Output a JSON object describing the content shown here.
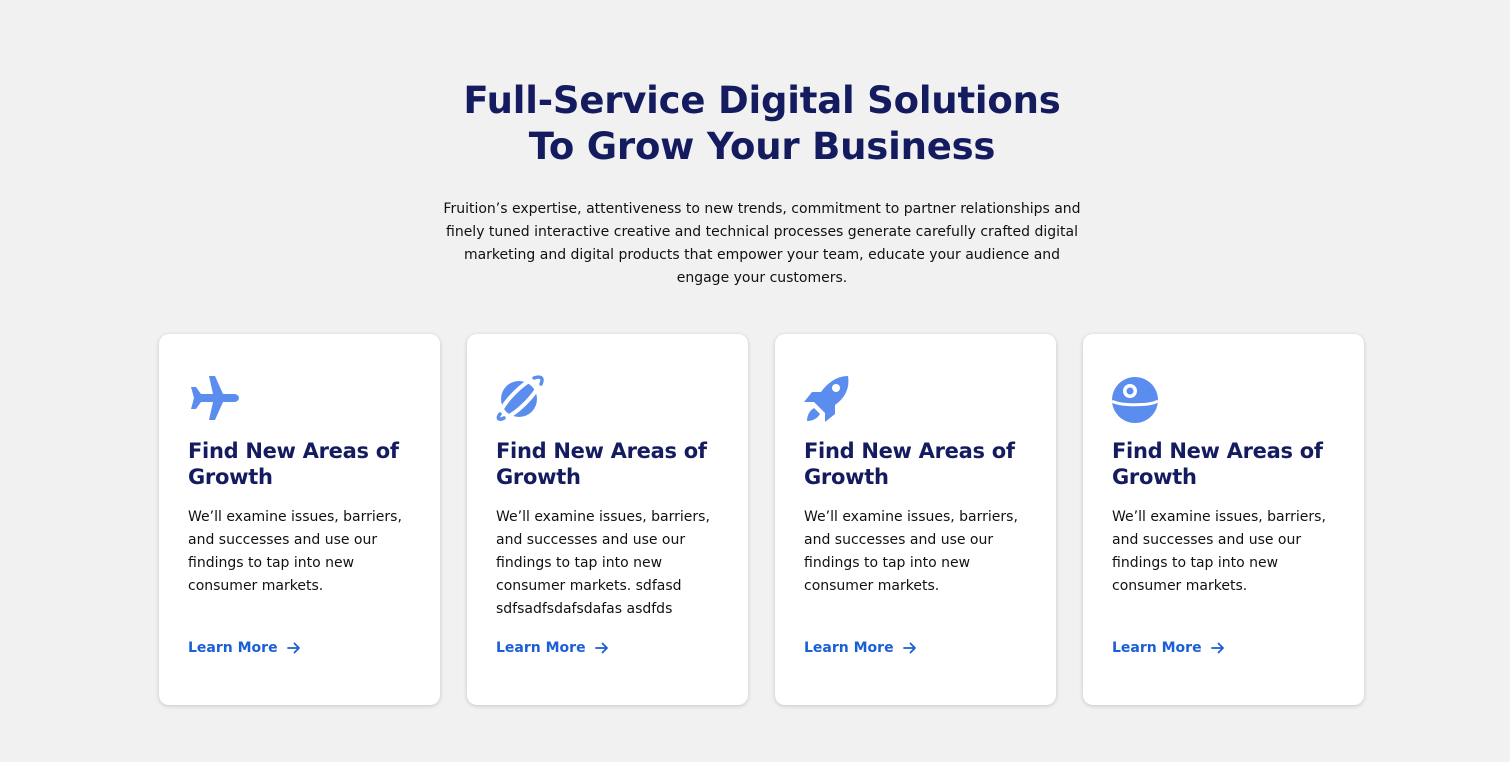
{
  "heading": {
    "line1": "Full-Service Digital Solutions",
    "line2": "To Grow Your Business"
  },
  "intro": "Fruition’s expertise, attentiveness to new trends, commitment to partner relationships and finely tuned interactive creative and technical processes generate carefully crafted digital marketing and digital products that empower your team, educate your audience and engage your customers.",
  "colors": {
    "heading": "#141c5f",
    "icon": "#5b8def",
    "link": "#1a5fd6",
    "background": "#f0f1f0"
  },
  "cards": [
    {
      "icon": "airplane-icon",
      "title": "Find New Areas of Growth",
      "body": "We’ll examine issues, barriers, and successes and use our findings to tap into new consumer markets.",
      "link": "Learn More"
    },
    {
      "icon": "planet-icon",
      "title": "Find New Areas of Growth",
      "body": "We’ll examine issues, barriers, and successes and use our findings to tap into new consumer markets. sdfasd sdfsadfsdafsdafas asdfds",
      "link": "Learn More"
    },
    {
      "icon": "rocket-icon",
      "title": "Find New Areas of Growth",
      "body": "We’ll examine issues, barriers, and successes and use our findings to tap into new consumer markets.",
      "link": "Learn More"
    },
    {
      "icon": "space-station-icon",
      "title": "Find New Areas of Growth",
      "body": "We’ll examine issues, barriers, and successes and use our findings to tap into new consumer markets.",
      "link": "Learn More"
    }
  ]
}
